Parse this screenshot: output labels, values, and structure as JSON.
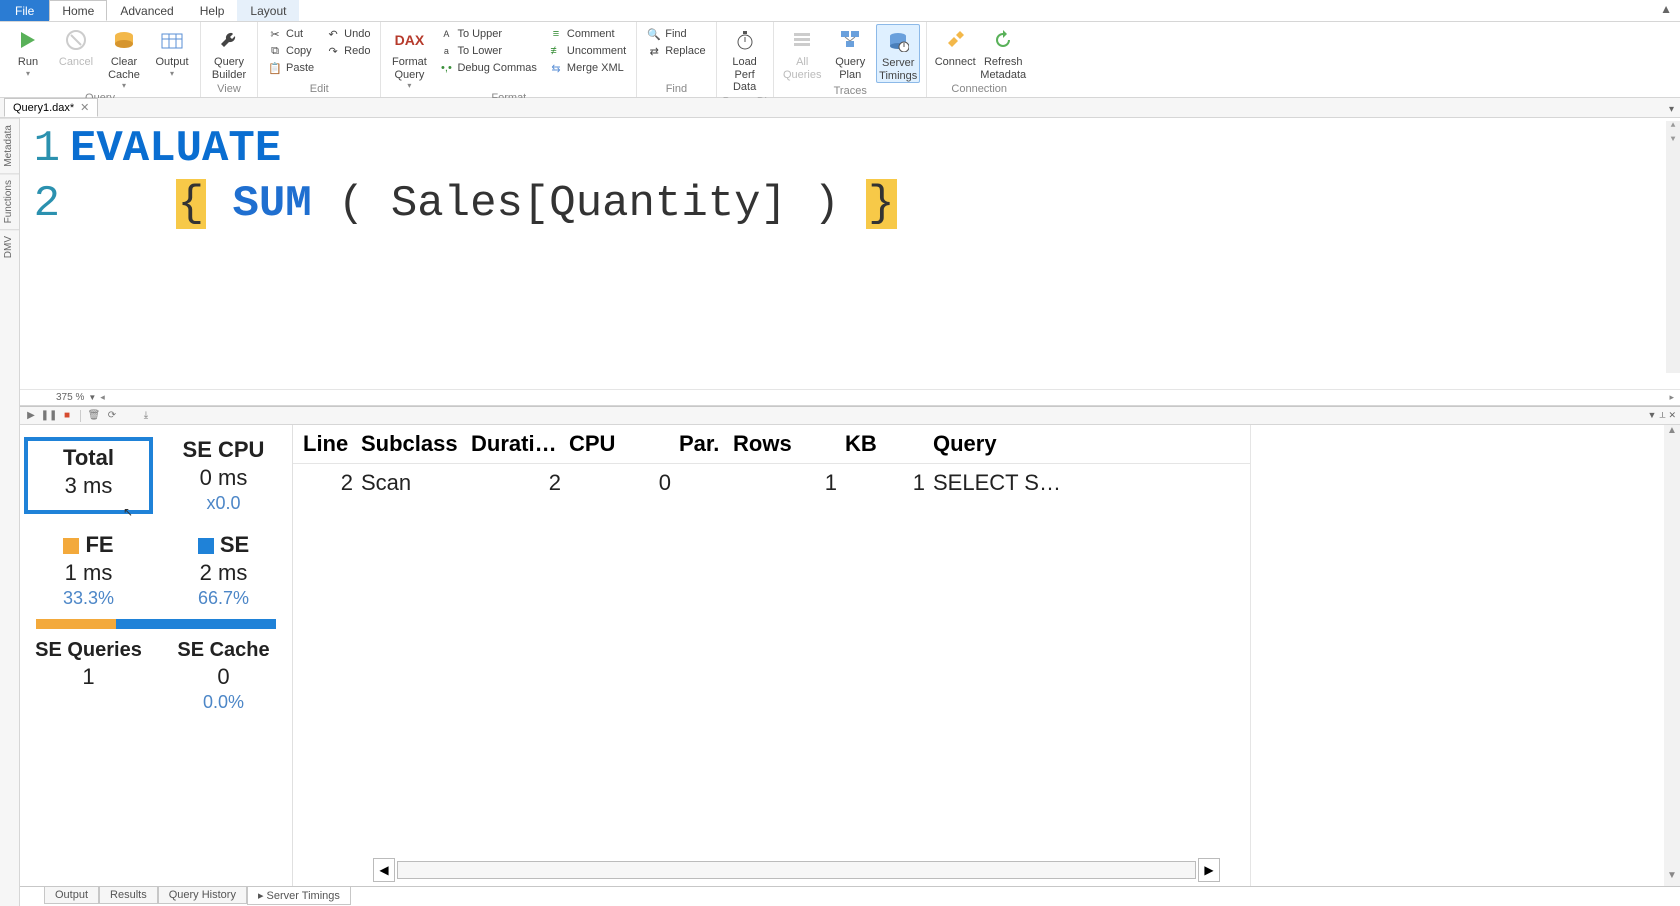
{
  "ribbon": {
    "tabs": {
      "file": "File",
      "home": "Home",
      "advanced": "Advanced",
      "help": "Help",
      "layout": "Layout"
    },
    "groups": {
      "query": {
        "run": "Run",
        "cancel": "Cancel",
        "clear_cache": "Clear\nCache",
        "output": "Output",
        "label": "Query"
      },
      "view": {
        "query_builder": "Query\nBuilder",
        "label": "View"
      },
      "edit": {
        "cut": "Cut",
        "copy": "Copy",
        "paste": "Paste",
        "undo": "Undo",
        "redo": "Redo",
        "label": "Edit"
      },
      "format": {
        "dax": "DAX",
        "format_query": "Format\nQuery",
        "to_upper": "To Upper",
        "to_lower": "To Lower",
        "debug_commas": "Debug Commas",
        "comment": "Comment",
        "uncomment": "Uncomment",
        "merge_xml": "Merge XML",
        "label": "Format"
      },
      "find": {
        "find": "Find",
        "replace": "Replace",
        "label": "Find"
      },
      "powerbi": {
        "load_perf": "Load Perf\nData",
        "label": "Power BI"
      },
      "traces": {
        "all_queries": "All\nQueries",
        "query_plan": "Query\nPlan",
        "server_timings": "Server\nTimings",
        "label": "Traces"
      },
      "conn": {
        "connect": "Connect",
        "refresh_md": "Refresh\nMetadata",
        "label": "Connection"
      }
    }
  },
  "doc_tab": {
    "name": "Query1.dax*"
  },
  "side_tabs": {
    "metadata": "Metadata",
    "functions": "Functions",
    "dmv": "DMV"
  },
  "editor": {
    "zoom": "375 %",
    "lines": [
      "1",
      "2"
    ],
    "line1_kw": "EVALUATE",
    "line2_open": "{",
    "line2_fn": "SUM",
    "line2_open_paren": " ( ",
    "line2_arg": "Sales[Quantity]",
    "line2_close_paren": " ) ",
    "line2_close": "}"
  },
  "timings": {
    "total": {
      "label": "Total",
      "value": "3 ms"
    },
    "secpu": {
      "label": "SE CPU",
      "value": "0 ms",
      "sub": "x0.0"
    },
    "fe": {
      "label": "FE",
      "value": "1 ms",
      "pct": "33.3%"
    },
    "se": {
      "label": "SE",
      "value": "2 ms",
      "pct": "66.7%"
    },
    "fe_width_pct": 33.3,
    "seq": {
      "label": "SE Queries",
      "value": "1"
    },
    "secache": {
      "label": "SE Cache",
      "value": "0",
      "pct": "0.0%"
    }
  },
  "events": {
    "headers": {
      "line": "Line",
      "subclass": "Subclass",
      "duration": "Duration",
      "cpu": "CPU",
      "par": "Par.",
      "rows": "Rows",
      "kb": "KB",
      "query": "Query"
    },
    "rows": [
      {
        "line": "2",
        "subclass": "Scan",
        "duration": "2",
        "cpu": "0",
        "par": "",
        "rows": "1",
        "kb": "1",
        "query": "SELECT SUM ("
      }
    ]
  },
  "bottom_tabs": {
    "output": "Output",
    "results": "Results",
    "history": "Query History",
    "server_timings": "Server Timings"
  }
}
